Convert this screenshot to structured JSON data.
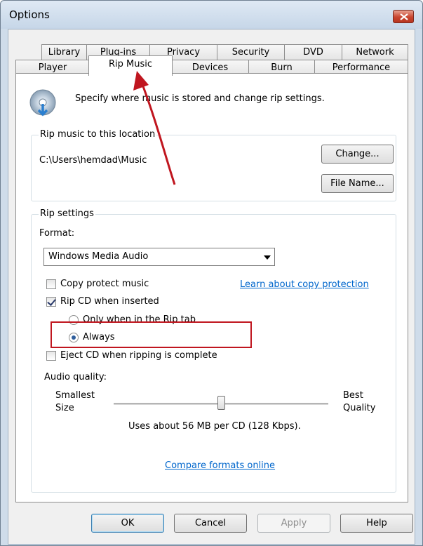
{
  "window": {
    "title": "Options"
  },
  "tabs": {
    "row1": [
      "Library",
      "Plug-ins",
      "Privacy",
      "Security",
      "DVD",
      "Network"
    ],
    "row2": [
      "Player",
      "Rip Music",
      "Devices",
      "Burn",
      "Performance"
    ],
    "active": "Rip Music"
  },
  "header": {
    "description": "Specify where music is stored and change rip settings."
  },
  "location": {
    "group_label": "Rip music to this location",
    "path": "C:\\Users\\hemdad\\Music",
    "change_label": "Change...",
    "filename_label": "File Name..."
  },
  "settings": {
    "group_label": "Rip settings",
    "format_label": "Format:",
    "format_value": "Windows Media Audio",
    "copy_protect_label": "Copy protect music",
    "copy_protect_checked": false,
    "learn_link": "Learn about copy protection",
    "rip_cd_label": "Rip CD when inserted",
    "rip_cd_checked": true,
    "only_rip_tab_label": "Only when in the Rip tab",
    "always_label": "Always",
    "selected_mode": "Always",
    "eject_label": "Eject CD when ripping is complete",
    "eject_checked": false,
    "audio_quality_label": "Audio quality:",
    "smallest_label_1": "Smallest",
    "smallest_label_2": "Size",
    "best_label_1": "Best",
    "best_label_2": "Quality",
    "quality_value_fraction": 0.5,
    "usage_text": "Uses about 56 MB per CD (128 Kbps).",
    "compare_link": "Compare formats online"
  },
  "footer": {
    "ok": "OK",
    "cancel": "Cancel",
    "apply": "Apply",
    "help": "Help"
  },
  "annotation_color": "#c0161f",
  "icons": [
    "disc-icon",
    "close-icon",
    "annotation-arrow"
  ]
}
